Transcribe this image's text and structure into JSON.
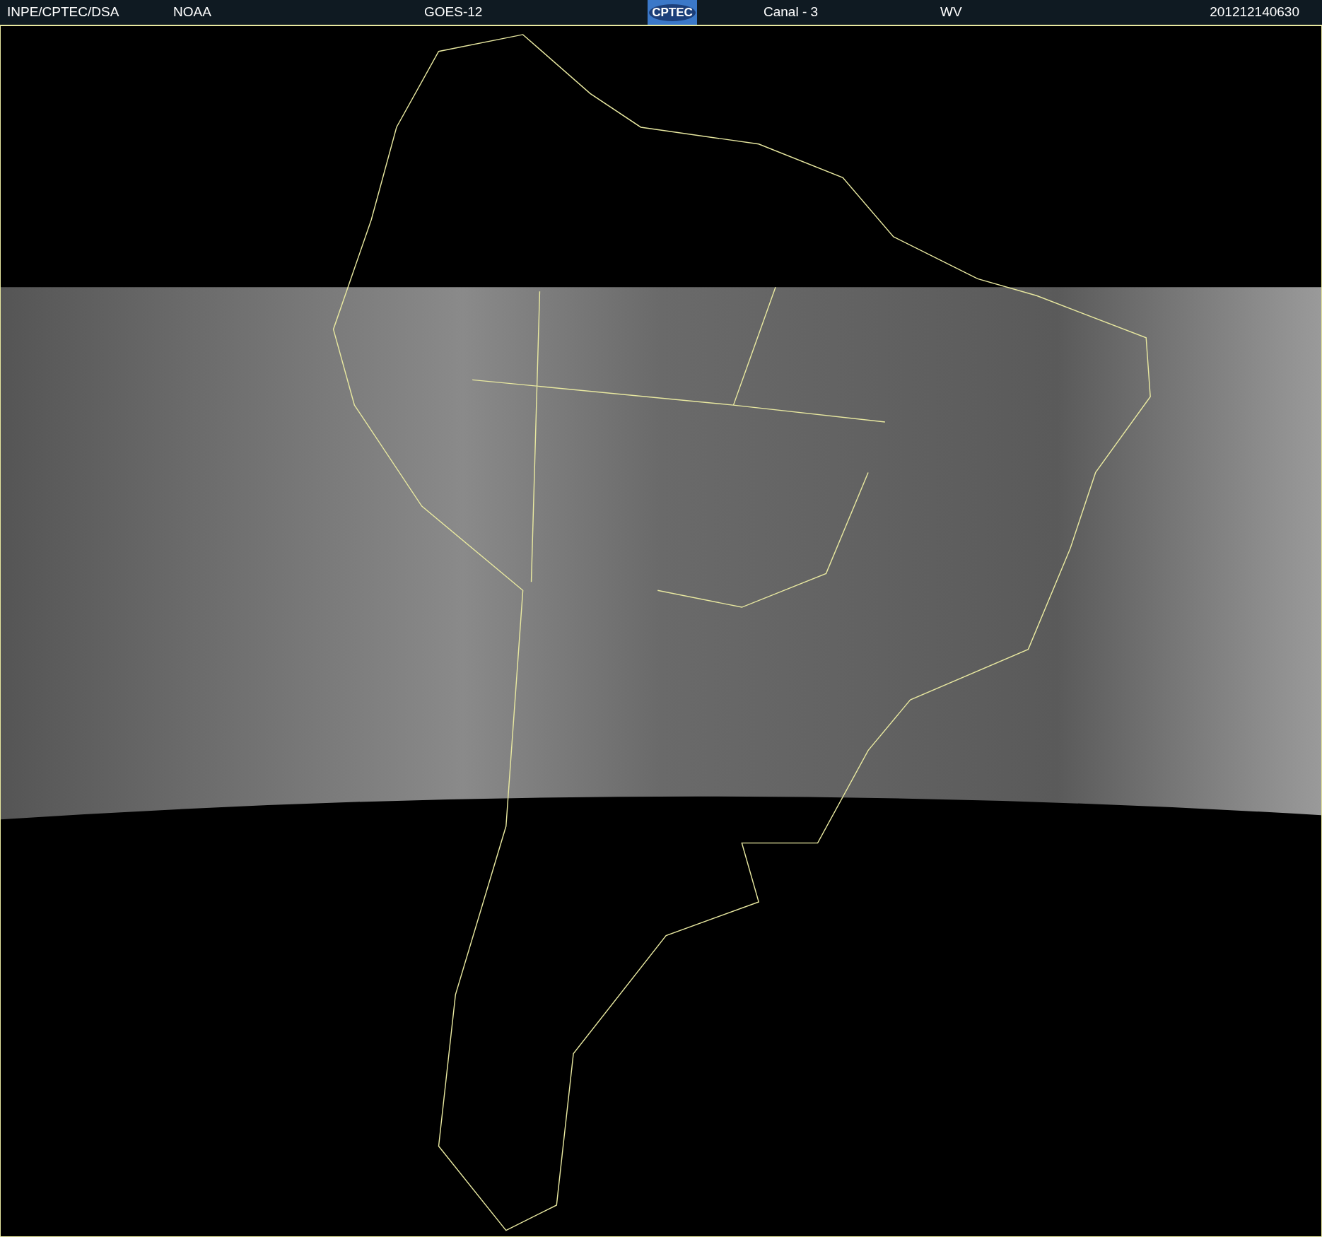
{
  "header": {
    "source": "INPE/CPTEC/DSA",
    "agency": "NOAA",
    "satellite": "GOES-12",
    "logo_text": "CPTEC",
    "channel": "Canal - 3",
    "band": "WV",
    "timestamp": "201212140630"
  }
}
